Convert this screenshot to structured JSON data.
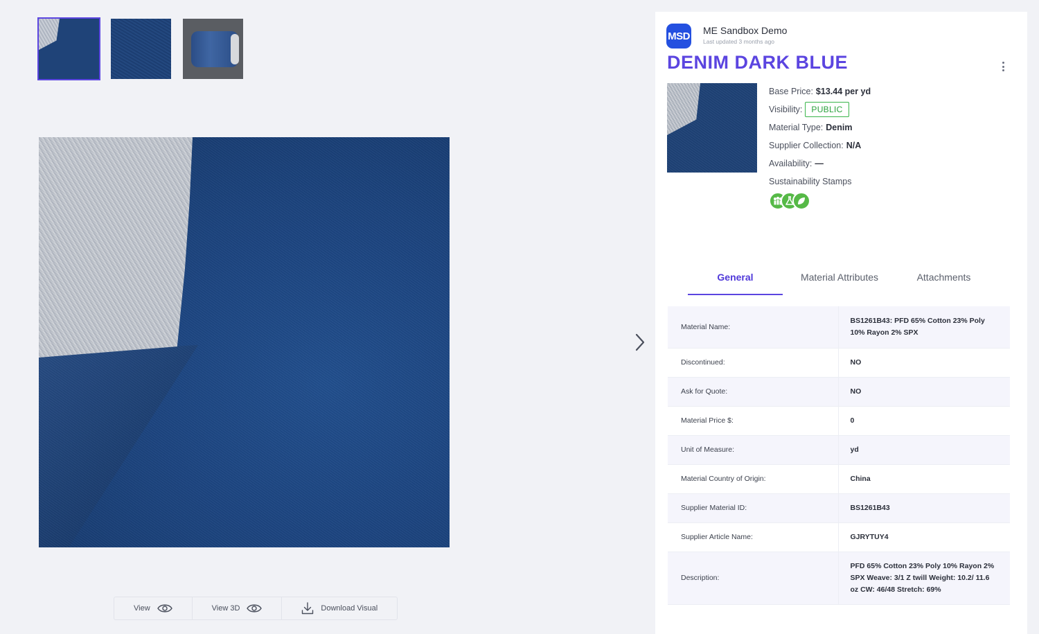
{
  "gallery": {
    "thumbnails": [
      "thumb-fold-swatch",
      "thumb-denim-closeup",
      "thumb-fabric-roll"
    ],
    "next_icon": "chevron-right-icon"
  },
  "actions": {
    "view_label": "View",
    "view3d_label": "View 3D",
    "download_label": "Download Visual"
  },
  "header": {
    "org_logo_text": "MSD",
    "org_name": "ME Sandbox Demo",
    "last_updated": "Last updated 3 months ago",
    "title": "DENIM DARK BLUE"
  },
  "summary": {
    "base_price_label": "Base Price:",
    "base_price_value": "$13.44 per yd",
    "visibility_label": "Visibility:",
    "visibility_value": "PUBLIC",
    "material_type_label": "Material Type:",
    "material_type_value": "Denim",
    "supplier_collection_label": "Supplier Collection:",
    "supplier_collection_value": "N/A",
    "availability_label": "Availability:",
    "availability_value": "—",
    "sustainability_label": "Sustainability Stamps",
    "stamp_icons": [
      "community-icon",
      "lab-flask-icon",
      "leaf-icon"
    ],
    "colors": {
      "accent": "#5b45e0",
      "public_green": "#39b54a",
      "stamp_green": "#56b947"
    }
  },
  "tabs": [
    {
      "label": "General",
      "active": true
    },
    {
      "label": "Material Attributes",
      "active": false
    },
    {
      "label": "Attachments",
      "active": false
    }
  ],
  "general": {
    "rows": [
      {
        "label": "Material Name:",
        "value": "BS1261B43: PFD 65% Cotton 23% Poly 10% Rayon 2% SPX"
      },
      {
        "label": "Discontinued:",
        "value": "NO"
      },
      {
        "label": "Ask for Quote:",
        "value": "NO"
      },
      {
        "label": "Material Price $:",
        "value": "0"
      },
      {
        "label": "Unit of Measure:",
        "value": "yd"
      },
      {
        "label": "Material Country of Origin:",
        "value": "China"
      },
      {
        "label": "Supplier Material ID:",
        "value": "BS1261B43"
      },
      {
        "label": "Supplier Article Name:",
        "value": " GJRYTUY4"
      },
      {
        "label": "Description:",
        "value": "PFD 65% Cotton 23% Poly 10% Rayon 2% SPX Weave: 3/1 Z twill Weight: 10.2/ 11.6 oz CW: 46/48 Stretch: 69%"
      }
    ]
  }
}
